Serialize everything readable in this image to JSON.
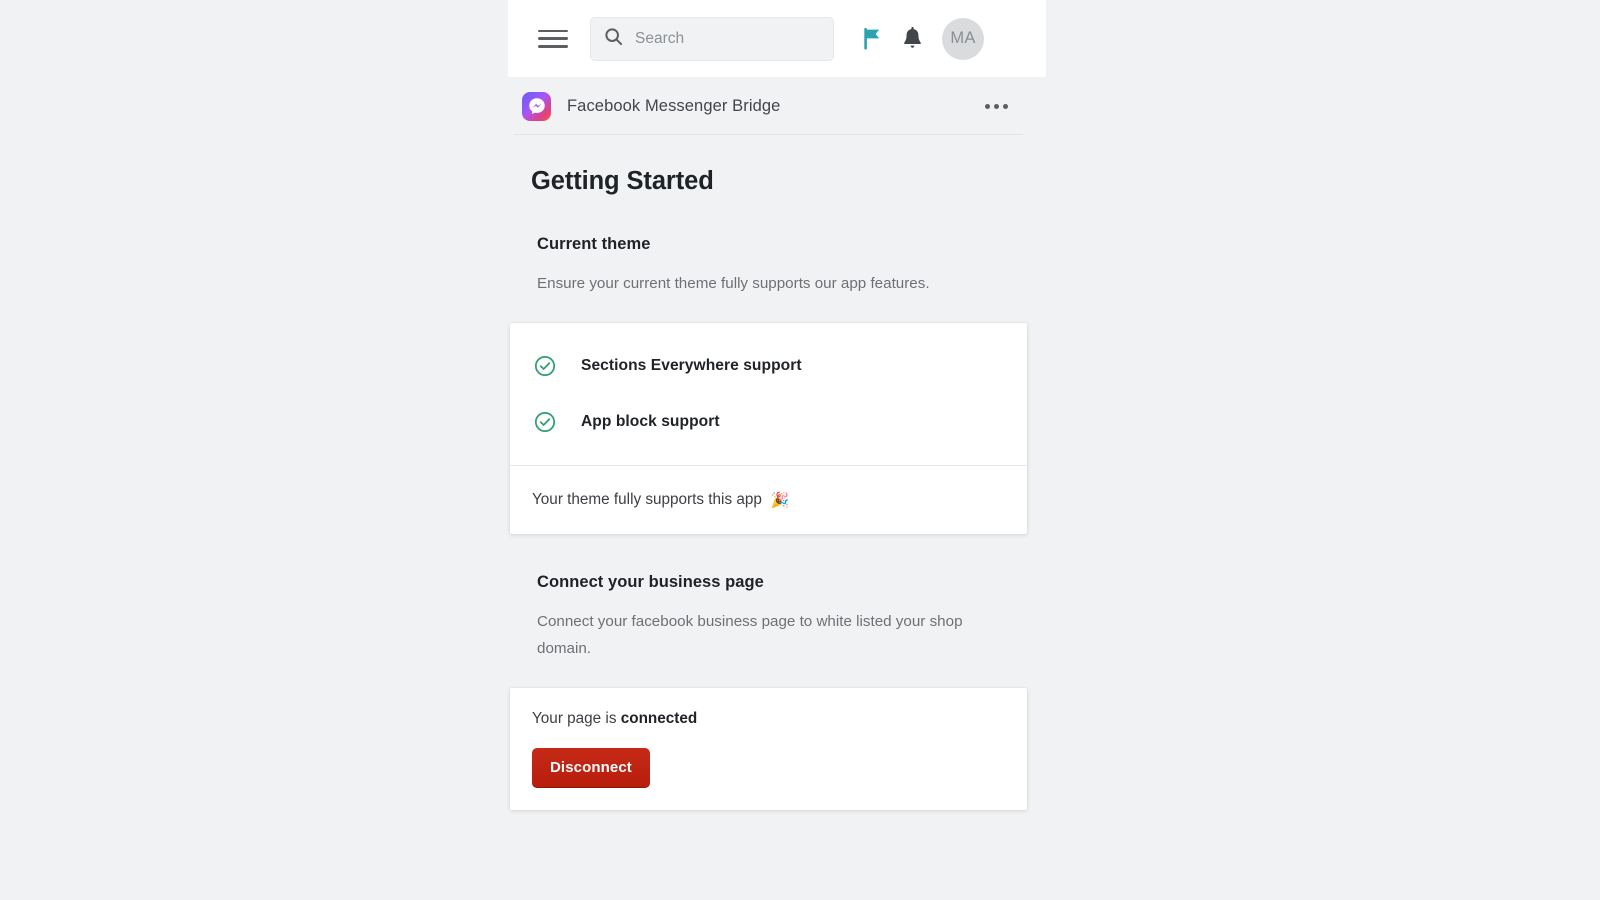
{
  "topbar": {
    "menu_icon": "hamburger-menu-icon",
    "search": {
      "icon": "search-icon",
      "value": "",
      "placeholder": "Search"
    },
    "flag_icon": "flag-icon",
    "flag_color": "#2ba3b0",
    "notifications_icon": "bell-icon",
    "avatar_initials": "MA"
  },
  "app_header": {
    "logo_icon": "facebook-messenger-icon",
    "title": "Facebook Messenger Bridge",
    "more_actions_icon": "ellipsis-horizontal-icon"
  },
  "page": {
    "title": "Getting Started"
  },
  "theme_section": {
    "heading": "Current theme",
    "description": "Ensure your current theme fully supports our app features.",
    "checks": [
      {
        "icon": "circle-check-icon",
        "label": "Sections Everywhere support",
        "status": "success"
      },
      {
        "icon": "circle-check-icon",
        "label": "App block support",
        "status": "success"
      }
    ],
    "support_note": "Your theme fully supports this app",
    "support_emoji": "🎉",
    "success_color": "#2ea06e"
  },
  "connect_section": {
    "heading": "Connect your business page",
    "description": "Connect your facebook business page to white listed your shop domain.",
    "status_prefix": "Your page is",
    "status_value": "connected",
    "disconnect_label": "Disconnect",
    "disconnect_color": "#bf2012"
  }
}
